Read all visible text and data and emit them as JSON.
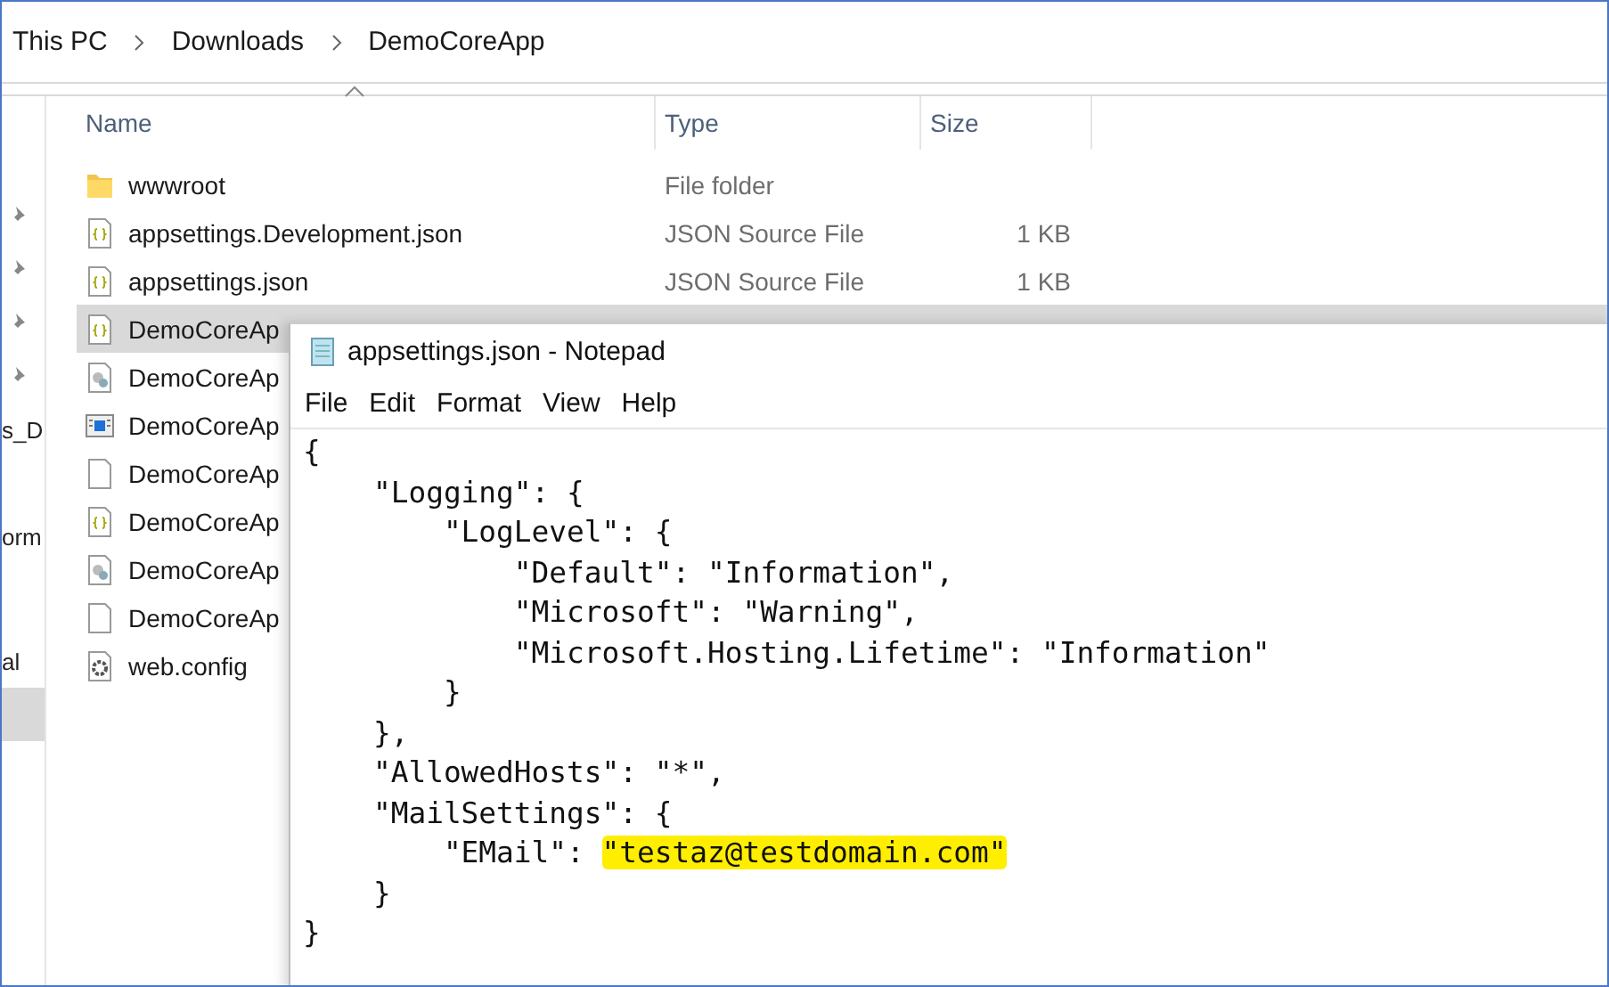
{
  "explorer": {
    "breadcrumb": [
      "This PC",
      "Downloads",
      "DemoCoreApp"
    ],
    "nav_pane": [
      {
        "label": "s_D",
        "selected": false
      },
      {
        "label": "orm",
        "selected": false
      },
      {
        "label": "al",
        "selected": false
      },
      {
        "selected": true
      }
    ],
    "columns": [
      "Name",
      "Type",
      "Size"
    ],
    "rows": [
      {
        "kind": "folder",
        "name": "wwwroot",
        "type": "File folder",
        "selected": false
      },
      {
        "kind": "json",
        "name": "appsettings.Development.json",
        "type": "JSON Source File",
        "size": "1 KB",
        "selected": false
      },
      {
        "kind": "json",
        "name": "appsettings.json",
        "type": "JSON Source File",
        "size": "1 KB",
        "selected": false
      },
      {
        "kind": "json",
        "name": "DemoCoreAp",
        "selected": true
      },
      {
        "kind": "settings",
        "name": "DemoCoreAp",
        "selected": false
      },
      {
        "kind": "app",
        "name": "DemoCoreAp",
        "selected": false
      },
      {
        "kind": "file",
        "name": "DemoCoreAp",
        "selected": false
      },
      {
        "kind": "json",
        "name": "DemoCoreAp",
        "selected": false
      },
      {
        "kind": "settings",
        "name": "DemoCoreAp",
        "selected": false
      },
      {
        "kind": "file",
        "name": "DemoCoreAp",
        "selected": false
      },
      {
        "kind": "gear",
        "name": "web.config",
        "selected": false
      }
    ]
  },
  "notepad": {
    "title": "appsettings.json - Notepad",
    "menu": [
      "File",
      "Edit",
      "Format",
      "View",
      "Help"
    ],
    "lines": [
      {
        "text": "{"
      },
      {
        "text": "    \"Logging\": {"
      },
      {
        "text": "        \"LogLevel\": {"
      },
      {
        "text": "            \"Default\": \"Information\","
      },
      {
        "text": "            \"Microsoft\": \"Warning\","
      },
      {
        "text": "            \"Microsoft.Hosting.Lifetime\": \"Information\""
      },
      {
        "text": "        }"
      },
      {
        "text": "    },"
      },
      {
        "text": "    \"AllowedHosts\": \"*\","
      },
      {
        "text": "    \"MailSettings\": {"
      },
      {
        "text": "        \"EMail\": ",
        "highlighted_text": "\"testaz@testdomain.com\""
      },
      {
        "text": "    }"
      },
      {
        "text": "}"
      }
    ]
  }
}
